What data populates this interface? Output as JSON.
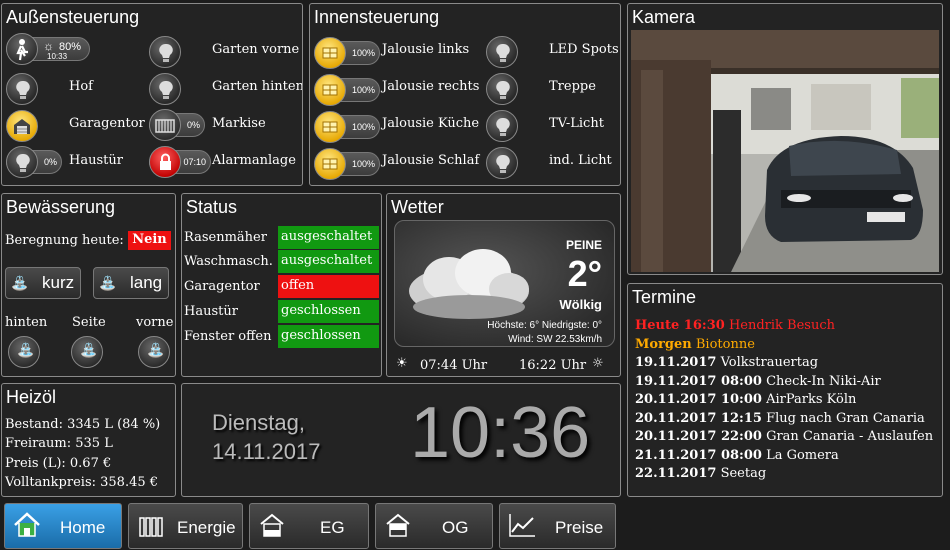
{
  "aussen": {
    "title": "Außensteuerung",
    "sun_pct": "80%",
    "sun_time": "10:33",
    "items": [
      "Garten vorne",
      "Hof",
      "Garten hinten",
      "Garagentor",
      "Markise",
      "Haustür",
      "Alarmanlage"
    ],
    "markise_pct": "0%",
    "haustuer_pct": "0%",
    "alarm_time": "07:10"
  },
  "innen": {
    "title": "Innensteuerung",
    "items": [
      "Jalousie links",
      "Jalousie rechts",
      "Jalousie Küche",
      "Jalousie Schlaf"
    ],
    "pcts": [
      "100%",
      "100%",
      "100%",
      "100%"
    ],
    "lights": [
      "LED Spots",
      "Treppe",
      "TV-Licht",
      "ind. Licht"
    ]
  },
  "kamera": {
    "title": "Kamera"
  },
  "bewaesserung": {
    "title": "Bewässerung",
    "heute_label": "Beregnung heute:",
    "heute_value": "Nein",
    "kurz": "kurz",
    "lang": "lang",
    "zones": [
      "hinten",
      "Seite",
      "vorne"
    ]
  },
  "status": {
    "title": "Status",
    "rows": [
      {
        "name": "Rasenmäher",
        "value": "ausgeschaltet",
        "color": "#119911"
      },
      {
        "name": "Waschmasch.",
        "value": "ausgeschaltet",
        "color": "#119911"
      },
      {
        "name": "Garagentor",
        "value": "offen",
        "color": "#ee1111"
      },
      {
        "name": "Haustür",
        "value": "geschlossen",
        "color": "#119911"
      },
      {
        "name": "Fenster offen",
        "value": "geschlossen",
        "color": "#119911"
      }
    ]
  },
  "wetter": {
    "title": "Wetter",
    "city": "PEINE",
    "temp": "2°",
    "condition": "Wölkig",
    "hilo": "Höchste: 6° Niedrigste: 0°",
    "wind": "Wind: SW 22.53km/h",
    "sunrise": "07:44 Uhr",
    "sunset": "16:22 Uhr"
  },
  "termine": {
    "title": "Termine",
    "entries": [
      {
        "when": "Heute 16:30",
        "what": "Hendrik Besuch",
        "color": "#ff2222"
      },
      {
        "when": "Morgen",
        "what": "Biotonne",
        "color": "#ffaa00"
      },
      {
        "when": "19.11.2017",
        "what": "Volkstrauertag",
        "color": "#ffffff"
      },
      {
        "when": "19.11.2017 08:00",
        "what": "Check-In Niki-Air",
        "color": "#ffffff"
      },
      {
        "when": "20.11.2017 10:00",
        "what": "AirParks Köln",
        "color": "#ffffff"
      },
      {
        "when": "20.11.2017 12:15",
        "what": "Flug nach Gran Canaria",
        "color": "#ffffff"
      },
      {
        "when": "20.11.2017 22:00",
        "what": "Gran Canaria - Auslaufen",
        "color": "#ffffff"
      },
      {
        "when": "21.11.2017 08:00",
        "what": "La Gomera",
        "color": "#ffffff"
      },
      {
        "when": "22.11.2017",
        "what": "Seetag",
        "color": "#ffffff"
      }
    ]
  },
  "heizoel": {
    "title": "Heizöl",
    "lines": [
      "Bestand: 3345 L (84 %)",
      "Freiraum: 535 L",
      "Preis (L): 0.67 €",
      "Volltankpreis: 358.45 €"
    ]
  },
  "clock": {
    "weekday": "Dienstag,",
    "date": "14.11.2017",
    "time": "10:36"
  },
  "nav": {
    "items": [
      "Home",
      "Energie",
      "EG",
      "OG",
      "Preise"
    ],
    "active": "Home"
  }
}
